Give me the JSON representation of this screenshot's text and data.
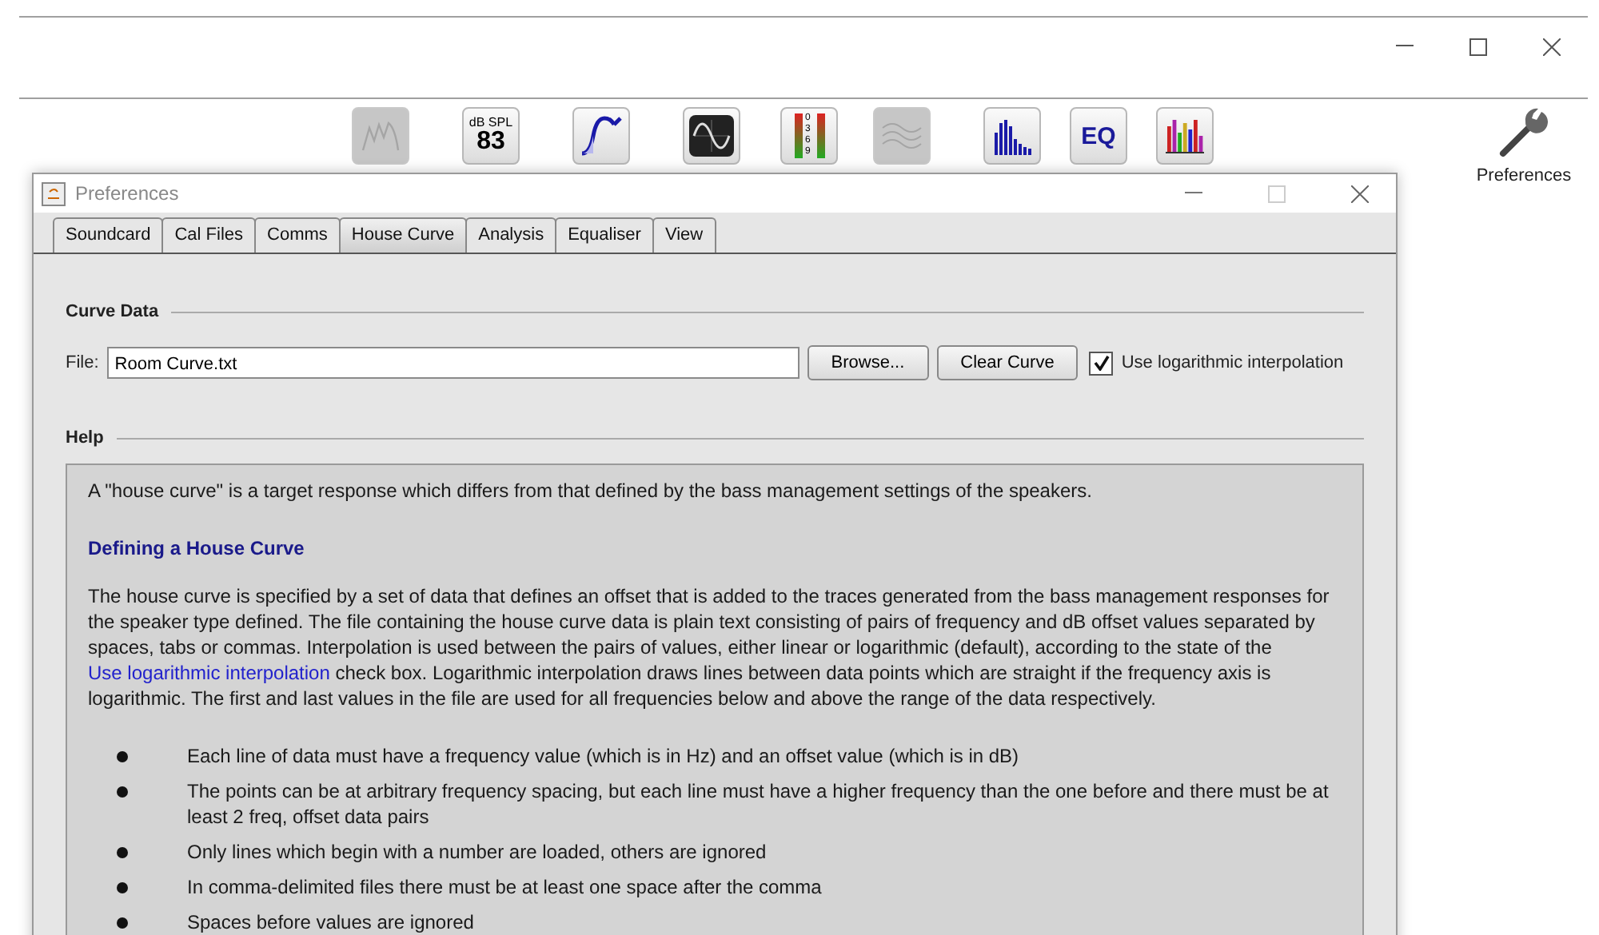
{
  "toolbar": [
    {
      "kind": "waterfall",
      "disabled": true
    },
    {
      "kind": "spl",
      "disabled": false,
      "caption": "dB SPL",
      "reading": "83"
    },
    {
      "kind": "sine",
      "disabled": false
    },
    {
      "kind": "scope",
      "disabled": false
    },
    {
      "kind": "meters",
      "disabled": false,
      "scale": "0369"
    },
    {
      "kind": "waves",
      "disabled": true
    },
    {
      "kind": "rta",
      "disabled": false
    },
    {
      "kind": "eq",
      "disabled": false,
      "label": "EQ"
    },
    {
      "kind": "bars",
      "disabled": false
    }
  ],
  "side_button": {
    "label": "Preferences"
  },
  "dialog": {
    "title": "Preferences",
    "tabs": [
      {
        "label": "Soundcard",
        "selected": false
      },
      {
        "label": "Cal Files",
        "selected": false
      },
      {
        "label": "Comms",
        "selected": false
      },
      {
        "label": "House Curve",
        "selected": true
      },
      {
        "label": "Analysis",
        "selected": false
      },
      {
        "label": "Equaliser",
        "selected": false
      },
      {
        "label": "View",
        "selected": false
      }
    ],
    "curve_data": {
      "heading": "Curve Data",
      "file_label": "File:",
      "file_value": "Room Curve.txt",
      "buttons": [
        "Browse...",
        "Clear Curve"
      ],
      "log_checkbox": {
        "label": "Use logarithmic interpolation",
        "checked": true
      }
    },
    "help": {
      "heading": "Help",
      "intro": "A \"house curve\" is a target response which differs from that defined by the bass management settings of the speakers.",
      "subheading": "Defining a House Curve",
      "paragraph_before": "The house curve is specified by a set of data that defines an offset that is added to the traces generated from the bass management responses for the speaker type defined. The file containing the house curve data is plain text consisting of pairs of frequency and dB offset values separated by spaces, tabs or commas. Interpolation is used between the pairs of values, either linear or logarithmic (default), according to the state of the",
      "paragraph_link": "Use logarithmic interpolation",
      "paragraph_after": "check box. Logarithmic interpolation draws lines between data points which are straight if the frequency axis is logarithmic. The first and last values in the file are used for all frequencies below and above the range of the data respectively.",
      "bullets": [
        "Each line of data must have a frequency value (which is in Hz) and an offset value (which is in dB)",
        "The points can be at arbitrary frequency spacing, but each line must have a higher frequency than the one before and there must be at least 2 freq, offset data pairs",
        "Only lines which begin with a number are loaded, others are ignored",
        "In comma-delimited files there must be at least one space after the comma",
        "Spaces before values are ignored"
      ]
    }
  }
}
